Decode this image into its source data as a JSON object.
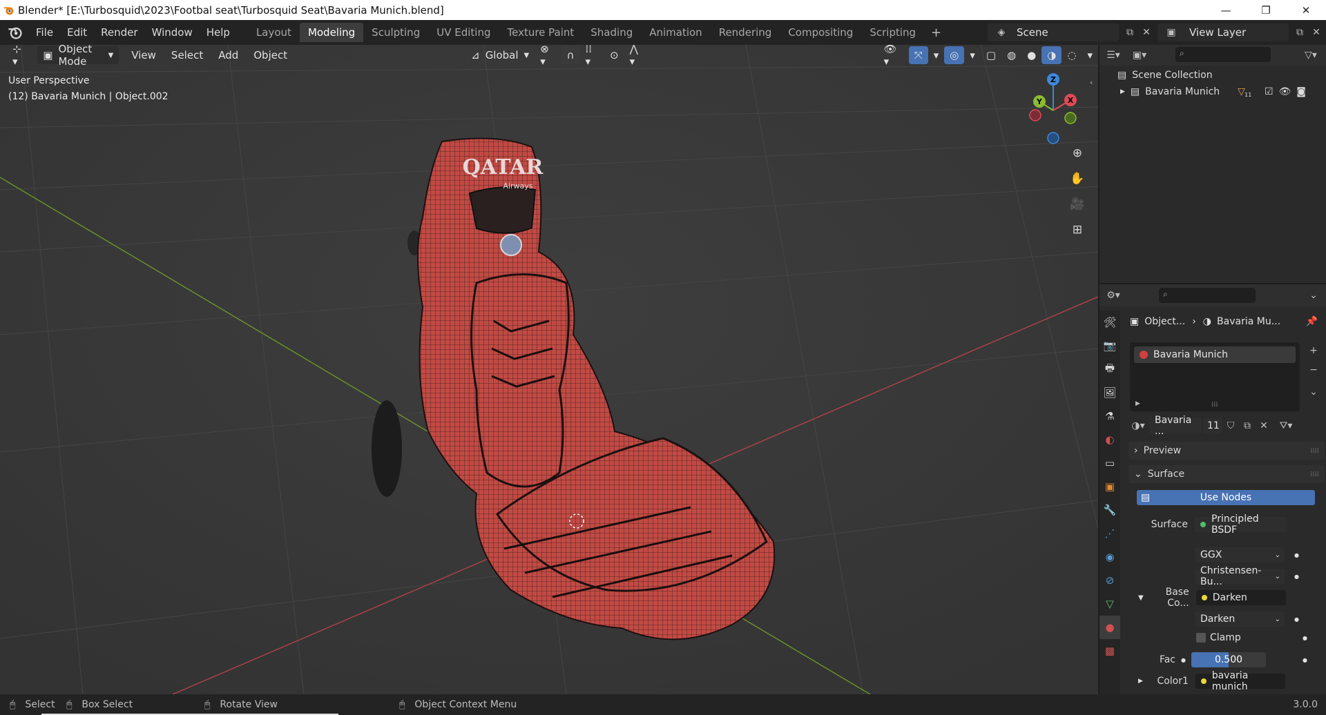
{
  "window": {
    "title": "Blender* [E:\\Turbosquid\\2023\\Footbal seat\\Turbosquid Seat\\Bavaria Munich.blend]",
    "minimize": "—",
    "maximize": "❐",
    "close": "✕"
  },
  "menu": [
    "File",
    "Edit",
    "Render",
    "Window",
    "Help"
  ],
  "workspaces": {
    "tabs": [
      "Layout",
      "Modeling",
      "Sculpting",
      "UV Editing",
      "Texture Paint",
      "Shading",
      "Animation",
      "Rendering",
      "Compositing",
      "Scripting"
    ],
    "active": "Modeling",
    "add": "+"
  },
  "scene": {
    "name": "Scene"
  },
  "view_layer": {
    "name": "View Layer"
  },
  "viewport": {
    "mode": "Object Mode",
    "menus": [
      "View",
      "Select",
      "Add",
      "Object"
    ],
    "transform_orientation": "Global",
    "perspective_label": "User Perspective",
    "object_label": "(12) Bavaria Munich | Object.002",
    "model_text": "QATAR",
    "model_subtext": "Airways",
    "gizmo": {
      "z": "Z",
      "y": "Y",
      "x": "X"
    }
  },
  "outliner": {
    "scene_collection": "Scene Collection",
    "collection": "Bavaria Munich",
    "collection_count": "11"
  },
  "properties": {
    "breadcrumb_object": "Object...",
    "breadcrumb_material": "Bavaria Mu...",
    "material_slot": "Bavaria Munich",
    "material_name": "Bavaria ...",
    "material_users": "11",
    "panel_preview": "Preview",
    "panel_surface": "Surface",
    "use_nodes": "Use Nodes",
    "surface_label": "Surface",
    "surface_shader": "Principled BSDF",
    "distribution": "GGX",
    "subsurface_method": "Christensen-Bu...",
    "base_color_label": "Base Co...",
    "base_color_node": "Darken",
    "blend_mode": "Darken",
    "clamp_label": "Clamp",
    "fac_label": "Fac",
    "fac_value": "0.500",
    "fac_fraction": 0.5,
    "color1_label": "Color1",
    "color1_value": "bavaria munich"
  },
  "statusbar": {
    "select": "Select",
    "box_select": "Box Select",
    "rotate_view": "Rotate View",
    "context_menu": "Object Context Menu",
    "version": "3.0.0"
  },
  "colors": {
    "accent_blue": "#4772b3",
    "active_tab": "#3d3d3d",
    "seat_red": "#c24a44",
    "x_axis": "#e04a58",
    "y_axis": "#8bbb32",
    "z_axis": "#3d88db"
  }
}
